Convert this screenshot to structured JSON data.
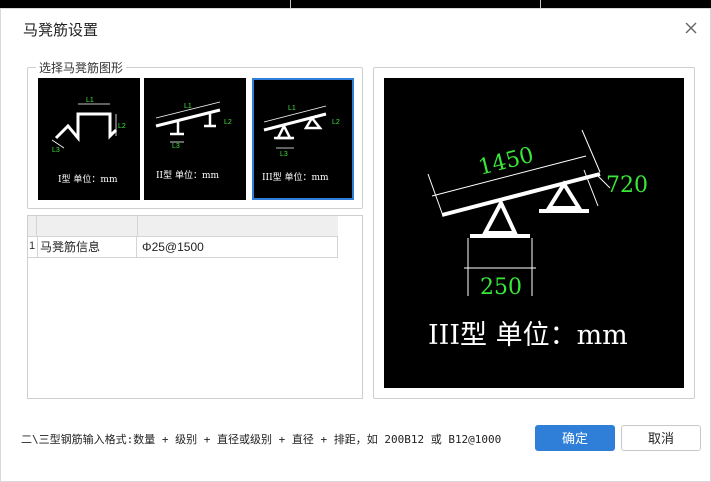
{
  "dialog": {
    "title": "马凳筋设置",
    "group_label": "选择马凳筋图形"
  },
  "shapes": [
    {
      "caption": "I型 单位：mm",
      "labels": [
        "L1",
        "L2",
        "L3"
      ]
    },
    {
      "caption": "II型 单位：mm",
      "labels": [
        "L1",
        "L2",
        "L3"
      ]
    },
    {
      "caption": "III型 单位：mm",
      "labels": [
        "L1",
        "L2",
        "L3"
      ],
      "selected": true
    }
  ],
  "table": {
    "rows": [
      {
        "index": "1",
        "name": "马凳筋信息",
        "value": "Φ25@1500"
      }
    ]
  },
  "preview": {
    "dim_top": "1450",
    "dim_side": "720",
    "dim_bottom": "250",
    "caption": "III型 单位：mm"
  },
  "hint": "二\\三型钢筋输入格式:数量 + 级别 + 直径或级别 + 直径 + 排距，如 200B12 或 B12@1000",
  "buttons": {
    "ok": "确定",
    "cancel": "取消"
  },
  "colors": {
    "accent": "#2f7fd8",
    "cad_green": "#39e639",
    "cad_white": "#ffffff"
  }
}
